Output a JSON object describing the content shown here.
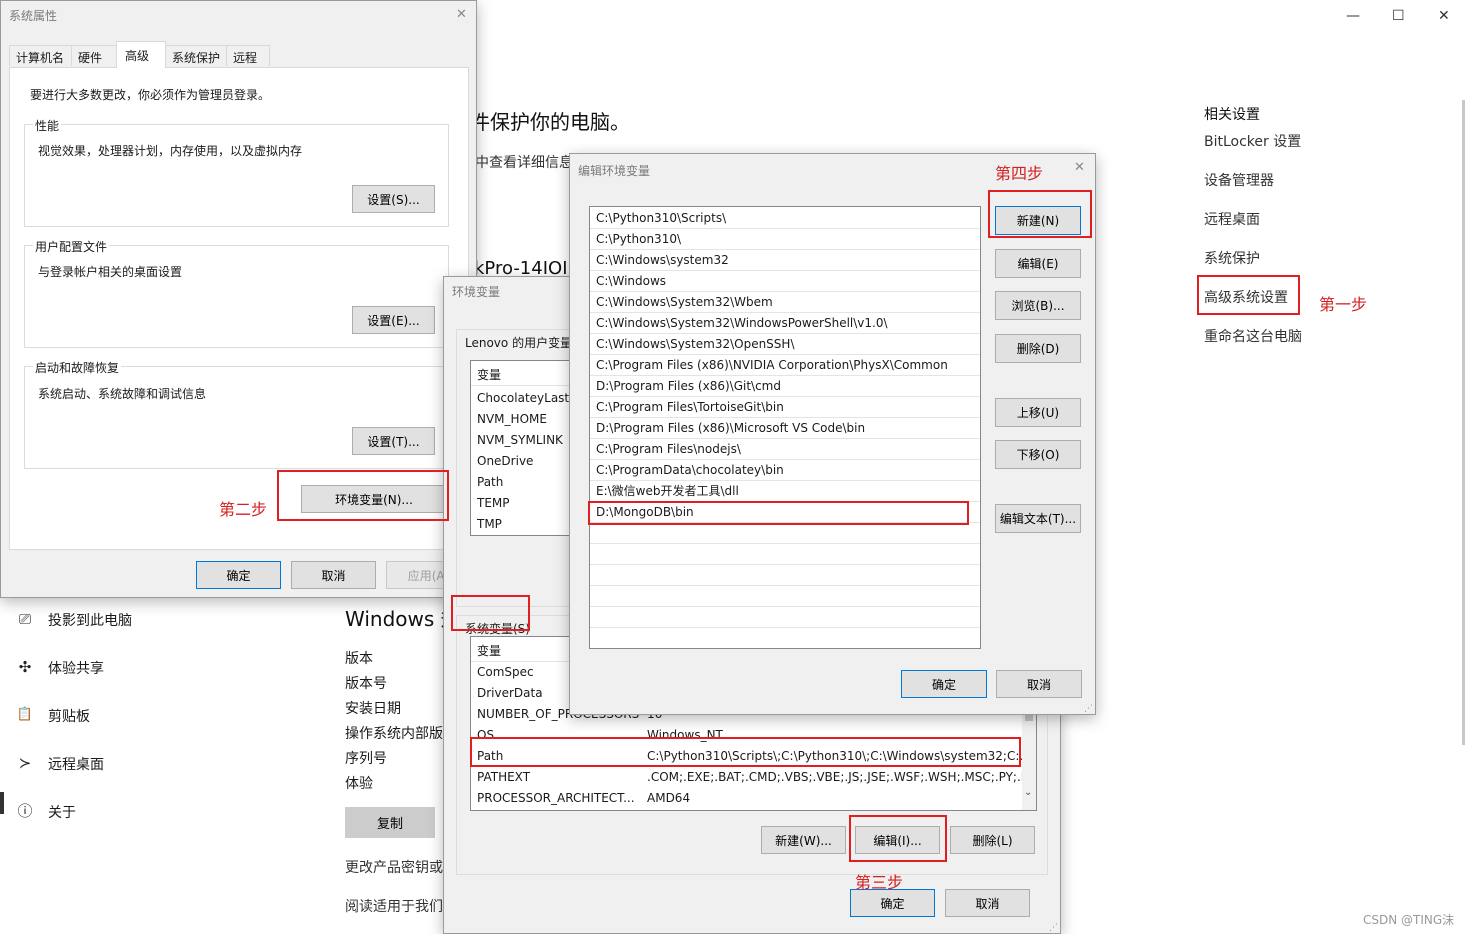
{
  "background_settings": {
    "window_controls": {
      "minimize": "—",
      "maximize": "☐",
      "close": "✕"
    },
    "heading_partial": "件保护你的电脑。",
    "subtext_partial": "中查看详细信息",
    "device_name_partial": "kPro-14IOI",
    "related_settings": {
      "title": "相关设置",
      "links": [
        "BitLocker 设置",
        "设备管理器",
        "远程桌面",
        "系统保护",
        "高级系统设置",
        "重命名这台电脑"
      ]
    },
    "nav": [
      {
        "icon": "projector-icon",
        "glyph": "⎚",
        "label": "投影到此电脑"
      },
      {
        "icon": "share-experience-icon",
        "glyph": "✣",
        "label": "体验共享"
      },
      {
        "icon": "clipboard-icon",
        "glyph": "📋",
        "label": "剪贴板"
      },
      {
        "icon": "remote-desktop-icon",
        "glyph": "≻",
        "label": "远程桌面"
      },
      {
        "icon": "info-icon",
        "glyph": "ⓘ",
        "label": "关于"
      }
    ],
    "windows_spec_title": "Windows 规",
    "spec_keys": [
      "版本",
      "版本号",
      "安装日期",
      "操作系统内部版",
      "序列号",
      "体验"
    ],
    "copy_button": "复制",
    "links": [
      "更改产品密钥或",
      "阅读适用于我们"
    ]
  },
  "system_properties": {
    "title": "系统属性",
    "tabs": [
      "计算机名",
      "硬件",
      "高级",
      "系统保护",
      "远程"
    ],
    "active_tab": "高级",
    "admin_note": "要进行大多数更改，你必须作为管理员登录。",
    "performance": {
      "label": "性能",
      "desc": "视觉效果，处理器计划，内存使用，以及虚拟内存",
      "button": "设置(S)..."
    },
    "user_profiles": {
      "label": "用户配置文件",
      "desc": "与登录帐户相关的桌面设置",
      "button": "设置(E)..."
    },
    "startup_recovery": {
      "label": "启动和故障恢复",
      "desc": "系统启动、系统故障和调试信息",
      "button": "设置(T)..."
    },
    "env_button": "环境变量(N)...",
    "ok": "确定",
    "cancel": "取消",
    "apply": "应用(A)"
  },
  "environment_variables": {
    "title": "环境变量",
    "user_section": "Lenovo 的用户变量",
    "user_header": "变量",
    "user_vars": [
      "ChocolateyLastP",
      "NVM_HOME",
      "NVM_SYMLINK",
      "OneDrive",
      "Path",
      "TEMP",
      "TMP"
    ],
    "system_section": "系统变量(S)",
    "system_header": "变量",
    "system_vars": [
      {
        "name": "ComSpec",
        "value": ""
      },
      {
        "name": "DriverData",
        "value": ""
      },
      {
        "name": "NUMBER_OF_PROCESSORS",
        "value": "16"
      },
      {
        "name": "OS",
        "value": "Windows_NT"
      },
      {
        "name": "Path",
        "value": "C:\\Python310\\Scripts\\;C:\\Python310\\;C:\\Windows\\system32;C:..."
      },
      {
        "name": "PATHEXT",
        "value": ".COM;.EXE;.BAT;.CMD;.VBS;.VBE;.JS;.JSE;.WSF;.WSH;.MSC;.PY;.P..."
      },
      {
        "name": "PROCESSOR_ARCHITECT...",
        "value": "AMD64"
      }
    ],
    "new_button": "新建(W)...",
    "edit_button": "编辑(I)...",
    "delete_button": "删除(L)",
    "ok": "确定",
    "cancel": "取消"
  },
  "edit_env_var": {
    "title": "编辑环境变量",
    "paths": [
      "C:\\Python310\\Scripts\\",
      "C:\\Python310\\",
      "C:\\Windows\\system32",
      "C:\\Windows",
      "C:\\Windows\\System32\\Wbem",
      "C:\\Windows\\System32\\WindowsPowerShell\\v1.0\\",
      "C:\\Windows\\System32\\OpenSSH\\",
      "C:\\Program Files (x86)\\NVIDIA Corporation\\PhysX\\Common",
      "D:\\Program Files (x86)\\Git\\cmd",
      "C:\\Program Files\\TortoiseGit\\bin",
      "D:\\Program Files (x86)\\Microsoft VS Code\\bin",
      "C:\\Program Files\\nodejs\\",
      "C:\\ProgramData\\chocolatey\\bin",
      "E:\\微信web开发者工具\\dll",
      "D:\\MongoDB\\bin"
    ],
    "buttons": {
      "new": "新建(N)",
      "edit": "编辑(E)",
      "browse": "浏览(B)...",
      "delete": "删除(D)",
      "move_up": "上移(U)",
      "move_down": "下移(O)",
      "edit_text": "编辑文本(T)..."
    },
    "ok": "确定",
    "cancel": "取消"
  },
  "annotations": {
    "step1": "第一步",
    "step2": "第二步",
    "step3": "第三步",
    "step4": "第四步",
    "accent_color": "#e02020"
  },
  "watermark": "CSDN @TING沫"
}
